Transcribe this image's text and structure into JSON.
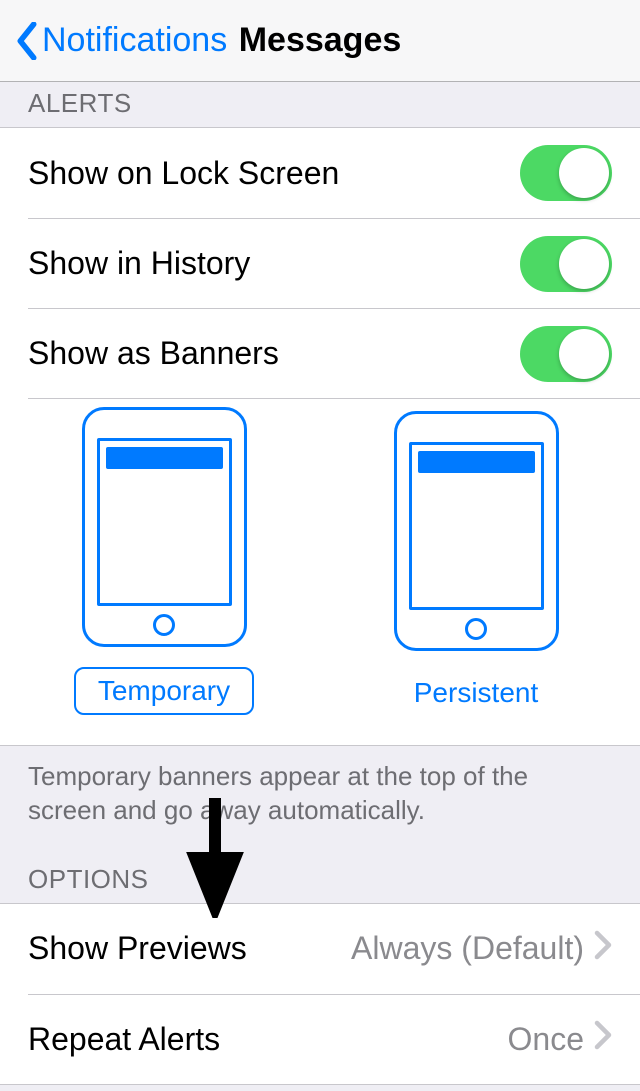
{
  "nav": {
    "back_label": "Notifications",
    "title": "Messages"
  },
  "sections": {
    "alerts": {
      "header": "ALERTS",
      "lock_screen": "Show on Lock Screen",
      "history": "Show in History",
      "banners": "Show as Banners",
      "toggles": {
        "lock_screen": true,
        "history": true,
        "banners": true
      },
      "banner_styles": {
        "temporary": "Temporary",
        "persistent": "Persistent",
        "selected": "temporary"
      },
      "footer": "Temporary banners appear at the top of the screen and go away automatically."
    },
    "options": {
      "header": "OPTIONS",
      "show_previews": {
        "label": "Show Previews",
        "value": "Always (Default)"
      },
      "repeat_alerts": {
        "label": "Repeat Alerts",
        "value": "Once"
      }
    }
  }
}
